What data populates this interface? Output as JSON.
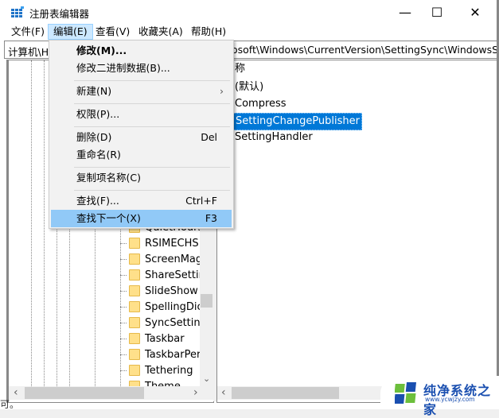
{
  "window": {
    "title": "注册表编辑器",
    "controls": {
      "minimize": "—",
      "maximize": "☐",
      "close": "✕"
    }
  },
  "menubar": {
    "items": [
      {
        "label": "文件(F)"
      },
      {
        "label": "编辑(E)",
        "active": true
      },
      {
        "label": "查看(V)"
      },
      {
        "label": "收藏夹(A)"
      },
      {
        "label": "帮助(H)"
      }
    ]
  },
  "address": {
    "prefix": "计算机\\H",
    "visible_path": "osoft\\Windows\\CurrentVersion\\SettingSync\\WindowsSet"
  },
  "edit_menu": {
    "items": [
      {
        "label": "修改(M)...",
        "shortcut": "",
        "bold": true
      },
      {
        "label": "修改二进制数据(B)...",
        "shortcut": ""
      },
      {
        "label": "新建(N)",
        "shortcut": "",
        "submenu": "›"
      },
      {
        "label": "权限(P)...",
        "shortcut": ""
      },
      {
        "label": "删除(D)",
        "shortcut": "Del"
      },
      {
        "label": "重命名(R)",
        "shortcut": ""
      },
      {
        "label": "复制项名称(C)",
        "shortcut": ""
      },
      {
        "label": "查找(F)...",
        "shortcut": "Ctrl+F"
      },
      {
        "label": "查找下一个(X)",
        "shortcut": "F3",
        "highlighted": true
      }
    ]
  },
  "tree": {
    "items": [
      {
        "label": "QuietHours"
      },
      {
        "label": "RSIMECHS"
      },
      {
        "label": "ScreenMagr"
      },
      {
        "label": "ShareSetting"
      },
      {
        "label": "SlideShow"
      },
      {
        "label": "SpellingDicti"
      },
      {
        "label": "SyncSettings"
      },
      {
        "label": "Taskbar"
      },
      {
        "label": "TaskbarPers"
      },
      {
        "label": "Tethering"
      },
      {
        "label": "Theme"
      }
    ]
  },
  "values_pane": {
    "header": "称",
    "rows": [
      {
        "name": "(默认)"
      },
      {
        "name": "Compress"
      },
      {
        "name": "SettingChangePublisher",
        "selected": true
      },
      {
        "name": "SettingHandler"
      }
    ]
  },
  "scroll": {
    "left": "‹",
    "right": "›",
    "down": "⌄"
  },
  "footer_text": "可。",
  "watermark": {
    "title": "纯净系统之家",
    "url": "www.ycwjzy.com"
  }
}
